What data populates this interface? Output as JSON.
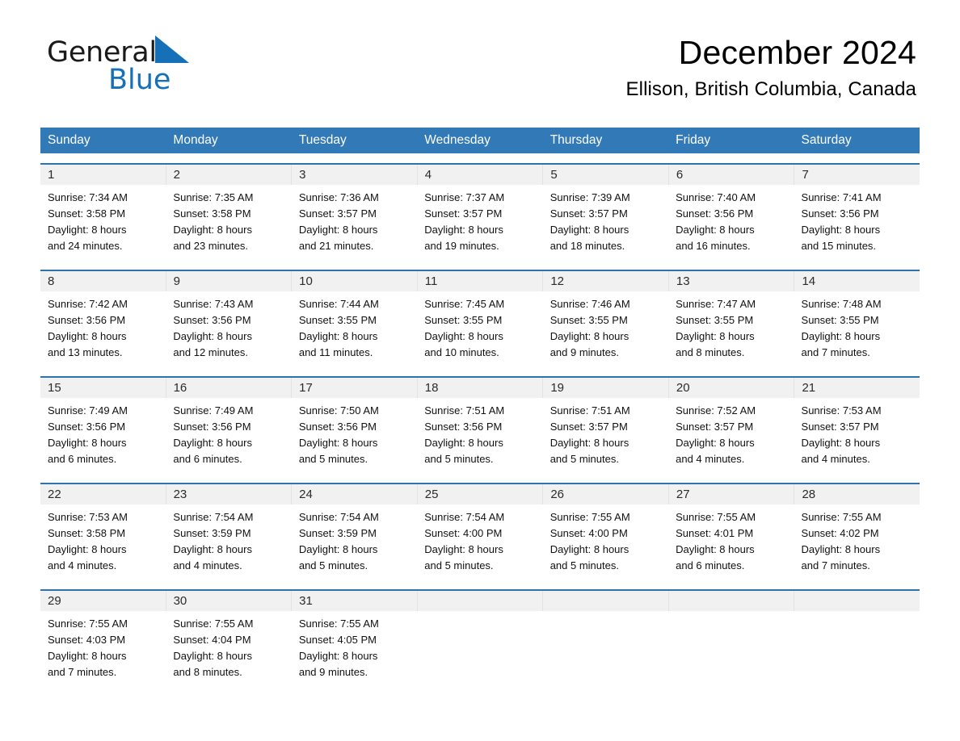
{
  "brand": {
    "name_part1": "General",
    "name_part2": "Blue",
    "accent_color": "#1570b8",
    "triangle_icon": "triangle-icon"
  },
  "header": {
    "title": "December 2024",
    "subtitle": "Ellison, British Columbia, Canada"
  },
  "calendar": {
    "header_bg": "#3279b7",
    "header_text_color": "#ffffff",
    "row_rule_color": "#2f73ad",
    "day_number_band_color": "#f1f1f1",
    "weekdays": [
      "Sunday",
      "Monday",
      "Tuesday",
      "Wednesday",
      "Thursday",
      "Friday",
      "Saturday"
    ],
    "weeks": [
      {
        "days": [
          {
            "number": "1",
            "sunrise": "Sunrise: 7:34 AM",
            "sunset": "Sunset: 3:58 PM",
            "daylight_line1": "Daylight: 8 hours",
            "daylight_line2": "and 24 minutes."
          },
          {
            "number": "2",
            "sunrise": "Sunrise: 7:35 AM",
            "sunset": "Sunset: 3:58 PM",
            "daylight_line1": "Daylight: 8 hours",
            "daylight_line2": "and 23 minutes."
          },
          {
            "number": "3",
            "sunrise": "Sunrise: 7:36 AM",
            "sunset": "Sunset: 3:57 PM",
            "daylight_line1": "Daylight: 8 hours",
            "daylight_line2": "and 21 minutes."
          },
          {
            "number": "4",
            "sunrise": "Sunrise: 7:37 AM",
            "sunset": "Sunset: 3:57 PM",
            "daylight_line1": "Daylight: 8 hours",
            "daylight_line2": "and 19 minutes."
          },
          {
            "number": "5",
            "sunrise": "Sunrise: 7:39 AM",
            "sunset": "Sunset: 3:57 PM",
            "daylight_line1": "Daylight: 8 hours",
            "daylight_line2": "and 18 minutes."
          },
          {
            "number": "6",
            "sunrise": "Sunrise: 7:40 AM",
            "sunset": "Sunset: 3:56 PM",
            "daylight_line1": "Daylight: 8 hours",
            "daylight_line2": "and 16 minutes."
          },
          {
            "number": "7",
            "sunrise": "Sunrise: 7:41 AM",
            "sunset": "Sunset: 3:56 PM",
            "daylight_line1": "Daylight: 8 hours",
            "daylight_line2": "and 15 minutes."
          }
        ]
      },
      {
        "days": [
          {
            "number": "8",
            "sunrise": "Sunrise: 7:42 AM",
            "sunset": "Sunset: 3:56 PM",
            "daylight_line1": "Daylight: 8 hours",
            "daylight_line2": "and 13 minutes."
          },
          {
            "number": "9",
            "sunrise": "Sunrise: 7:43 AM",
            "sunset": "Sunset: 3:56 PM",
            "daylight_line1": "Daylight: 8 hours",
            "daylight_line2": "and 12 minutes."
          },
          {
            "number": "10",
            "sunrise": "Sunrise: 7:44 AM",
            "sunset": "Sunset: 3:55 PM",
            "daylight_line1": "Daylight: 8 hours",
            "daylight_line2": "and 11 minutes."
          },
          {
            "number": "11",
            "sunrise": "Sunrise: 7:45 AM",
            "sunset": "Sunset: 3:55 PM",
            "daylight_line1": "Daylight: 8 hours",
            "daylight_line2": "and 10 minutes."
          },
          {
            "number": "12",
            "sunrise": "Sunrise: 7:46 AM",
            "sunset": "Sunset: 3:55 PM",
            "daylight_line1": "Daylight: 8 hours",
            "daylight_line2": "and 9 minutes."
          },
          {
            "number": "13",
            "sunrise": "Sunrise: 7:47 AM",
            "sunset": "Sunset: 3:55 PM",
            "daylight_line1": "Daylight: 8 hours",
            "daylight_line2": "and 8 minutes."
          },
          {
            "number": "14",
            "sunrise": "Sunrise: 7:48 AM",
            "sunset": "Sunset: 3:55 PM",
            "daylight_line1": "Daylight: 8 hours",
            "daylight_line2": "and 7 minutes."
          }
        ]
      },
      {
        "days": [
          {
            "number": "15",
            "sunrise": "Sunrise: 7:49 AM",
            "sunset": "Sunset: 3:56 PM",
            "daylight_line1": "Daylight: 8 hours",
            "daylight_line2": "and 6 minutes."
          },
          {
            "number": "16",
            "sunrise": "Sunrise: 7:49 AM",
            "sunset": "Sunset: 3:56 PM",
            "daylight_line1": "Daylight: 8 hours",
            "daylight_line2": "and 6 minutes."
          },
          {
            "number": "17",
            "sunrise": "Sunrise: 7:50 AM",
            "sunset": "Sunset: 3:56 PM",
            "daylight_line1": "Daylight: 8 hours",
            "daylight_line2": "and 5 minutes."
          },
          {
            "number": "18",
            "sunrise": "Sunrise: 7:51 AM",
            "sunset": "Sunset: 3:56 PM",
            "daylight_line1": "Daylight: 8 hours",
            "daylight_line2": "and 5 minutes."
          },
          {
            "number": "19",
            "sunrise": "Sunrise: 7:51 AM",
            "sunset": "Sunset: 3:57 PM",
            "daylight_line1": "Daylight: 8 hours",
            "daylight_line2": "and 5 minutes."
          },
          {
            "number": "20",
            "sunrise": "Sunrise: 7:52 AM",
            "sunset": "Sunset: 3:57 PM",
            "daylight_line1": "Daylight: 8 hours",
            "daylight_line2": "and 4 minutes."
          },
          {
            "number": "21",
            "sunrise": "Sunrise: 7:53 AM",
            "sunset": "Sunset: 3:57 PM",
            "daylight_line1": "Daylight: 8 hours",
            "daylight_line2": "and 4 minutes."
          }
        ]
      },
      {
        "days": [
          {
            "number": "22",
            "sunrise": "Sunrise: 7:53 AM",
            "sunset": "Sunset: 3:58 PM",
            "daylight_line1": "Daylight: 8 hours",
            "daylight_line2": "and 4 minutes."
          },
          {
            "number": "23",
            "sunrise": "Sunrise: 7:54 AM",
            "sunset": "Sunset: 3:59 PM",
            "daylight_line1": "Daylight: 8 hours",
            "daylight_line2": "and 4 minutes."
          },
          {
            "number": "24",
            "sunrise": "Sunrise: 7:54 AM",
            "sunset": "Sunset: 3:59 PM",
            "daylight_line1": "Daylight: 8 hours",
            "daylight_line2": "and 5 minutes."
          },
          {
            "number": "25",
            "sunrise": "Sunrise: 7:54 AM",
            "sunset": "Sunset: 4:00 PM",
            "daylight_line1": "Daylight: 8 hours",
            "daylight_line2": "and 5 minutes."
          },
          {
            "number": "26",
            "sunrise": "Sunrise: 7:55 AM",
            "sunset": "Sunset: 4:00 PM",
            "daylight_line1": "Daylight: 8 hours",
            "daylight_line2": "and 5 minutes."
          },
          {
            "number": "27",
            "sunrise": "Sunrise: 7:55 AM",
            "sunset": "Sunset: 4:01 PM",
            "daylight_line1": "Daylight: 8 hours",
            "daylight_line2": "and 6 minutes."
          },
          {
            "number": "28",
            "sunrise": "Sunrise: 7:55 AM",
            "sunset": "Sunset: 4:02 PM",
            "daylight_line1": "Daylight: 8 hours",
            "daylight_line2": "and 7 minutes."
          }
        ]
      },
      {
        "days": [
          {
            "number": "29",
            "sunrise": "Sunrise: 7:55 AM",
            "sunset": "Sunset: 4:03 PM",
            "daylight_line1": "Daylight: 8 hours",
            "daylight_line2": "and 7 minutes."
          },
          {
            "number": "30",
            "sunrise": "Sunrise: 7:55 AM",
            "sunset": "Sunset: 4:04 PM",
            "daylight_line1": "Daylight: 8 hours",
            "daylight_line2": "and 8 minutes."
          },
          {
            "number": "31",
            "sunrise": "Sunrise: 7:55 AM",
            "sunset": "Sunset: 4:05 PM",
            "daylight_line1": "Daylight: 8 hours",
            "daylight_line2": "and 9 minutes."
          },
          {
            "number": "",
            "sunrise": "",
            "sunset": "",
            "daylight_line1": "",
            "daylight_line2": ""
          },
          {
            "number": "",
            "sunrise": "",
            "sunset": "",
            "daylight_line1": "",
            "daylight_line2": ""
          },
          {
            "number": "",
            "sunrise": "",
            "sunset": "",
            "daylight_line1": "",
            "daylight_line2": ""
          },
          {
            "number": "",
            "sunrise": "",
            "sunset": "",
            "daylight_line1": "",
            "daylight_line2": ""
          }
        ]
      }
    ]
  }
}
